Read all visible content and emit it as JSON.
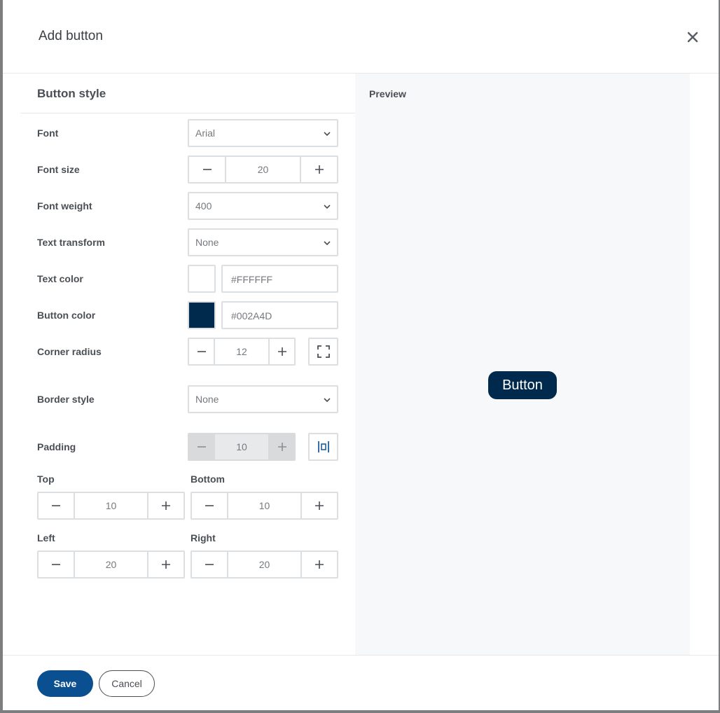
{
  "dialog": {
    "title": "Add button"
  },
  "button_style": {
    "heading": "Button style",
    "font": {
      "label": "Font",
      "value": "Arial"
    },
    "font_size": {
      "label": "Font size",
      "value": "20"
    },
    "font_weight": {
      "label": "Font weight",
      "value": "400"
    },
    "text_transform": {
      "label": "Text transform",
      "value": "None"
    },
    "text_color": {
      "label": "Text color",
      "value": "#FFFFFF"
    },
    "button_color": {
      "label": "Button color",
      "value": "#002A4D"
    },
    "corner_radius": {
      "label": "Corner radius",
      "value": "12"
    },
    "border_style": {
      "label": "Border style",
      "value": "None"
    },
    "padding": {
      "label": "Padding",
      "value": "10",
      "top": {
        "label": "Top",
        "value": "10"
      },
      "bottom": {
        "label": "Bottom",
        "value": "10"
      },
      "left": {
        "label": "Left",
        "value": "20"
      },
      "right": {
        "label": "Right",
        "value": "20"
      }
    }
  },
  "preview": {
    "heading": "Preview",
    "button_text": "Button"
  },
  "footer": {
    "save_label": "Save",
    "cancel_label": "Cancel"
  },
  "colors": {
    "primary": "#0a4f8f",
    "preview_button": "#002a4d",
    "preview_text": "#ffffff"
  }
}
